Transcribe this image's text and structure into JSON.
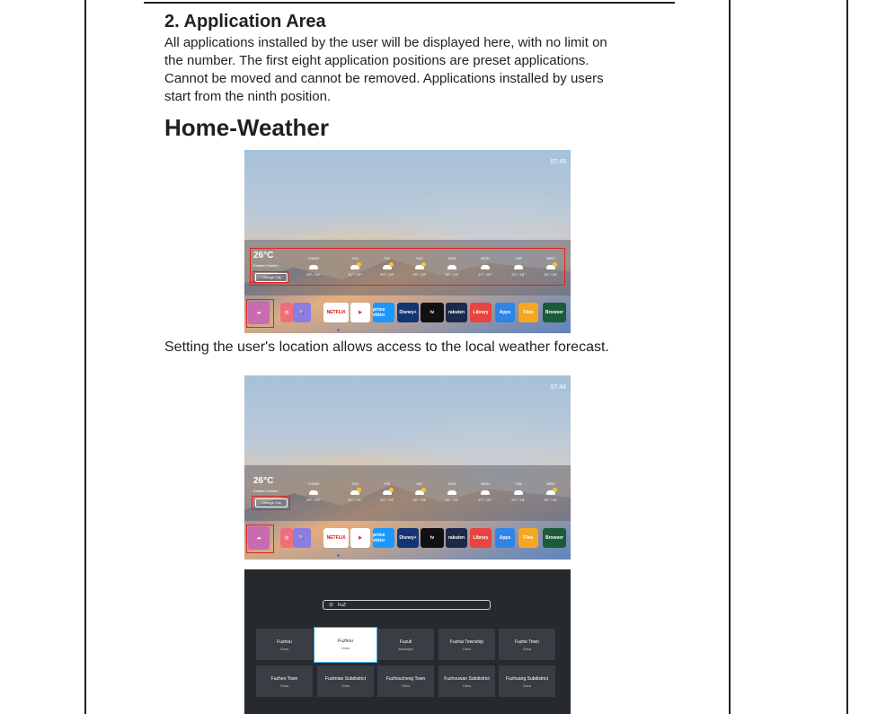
{
  "section": {
    "heading": "2. Application Area",
    "paragraph_lines": [
      "All applications installed by the user will be displayed here, with no limit on",
      "the number. The first eight application positions are preset applications.",
      "Cannot be moved and cannot be removed. Applications installed by users",
      "start from the  ninth position."
    ]
  },
  "weather_section": {
    "heading": "Home-Weather",
    "caption": "Setting the user's location allows access to the local weather forecast."
  },
  "screen1": {
    "clock": "07:45",
    "temperature": "26°C",
    "district": "Eastern District",
    "change_city": "Change City",
    "days": [
      {
        "name": "TODAY",
        "range": "29° / 24°",
        "icon": "cloud-icon"
      },
      {
        "name": "THU",
        "range": "31° / 23°",
        "icon": "sun-cloud-icon"
      },
      {
        "name": "FRI",
        "range": "30° / 24°",
        "icon": "sun-cloud-icon"
      },
      {
        "name": "SAT",
        "range": "29° / 23°",
        "icon": "sun-cloud-icon"
      },
      {
        "name": "SUN",
        "range": "28° / 23°",
        "icon": "cloud-icon"
      },
      {
        "name": "MON",
        "range": "27° / 22°",
        "icon": "cloud-icon"
      },
      {
        "name": "TUE",
        "range": "23° / 18°",
        "icon": "cloud-icon"
      },
      {
        "name": "WED",
        "range": "24° / 20°",
        "icon": "sun-cloud-icon"
      }
    ],
    "apps": [
      "NETFLIX",
      "",
      "prime video",
      "Disney+",
      "tv",
      "rakuten",
      "Library",
      "Apps",
      "Files",
      "Browser"
    ]
  },
  "screen2": {
    "clock": "07:44",
    "temperature": "26°C",
    "district": "Eastern District",
    "change_city": "Change City"
  },
  "city_search": {
    "query": "FuZ",
    "results": [
      {
        "city": "Fuzhou",
        "country": "China"
      },
      {
        "city": "Fuzhou",
        "country": "China"
      },
      {
        "city": "Fuzuli",
        "country": "Azerbaijan"
      },
      {
        "city": "Fuzhai Township",
        "country": "China"
      },
      {
        "city": "Fuzhe Town",
        "country": "China"
      },
      {
        "city": "Fuzhen Town",
        "country": "China"
      },
      {
        "city": "Fuzimiao Subdistrict",
        "country": "China"
      },
      {
        "city": "Fuzhoucheng Town",
        "country": "China"
      },
      {
        "city": "Fuzhouwan Subdistrict",
        "country": "China"
      },
      {
        "city": "Fuzhuang Subdistrict",
        "country": "China"
      }
    ]
  },
  "colors": {
    "highlight_red": "#e2231a",
    "selected_border": "#3aa8e0"
  }
}
